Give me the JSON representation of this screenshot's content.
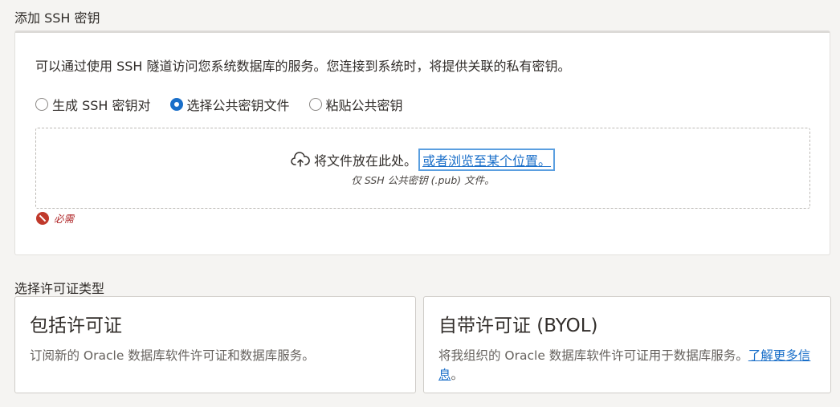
{
  "ssh_section": {
    "title": "添加 SSH 密钥",
    "description": "可以通过使用 SSH 隧道访问您系统数据库的服务。您连接到系统时，将提供关联的私有密钥。",
    "options": [
      {
        "label": "生成 SSH 密钥对",
        "selected": false
      },
      {
        "label": "选择公共密钥文件",
        "selected": true
      },
      {
        "label": "粘贴公共密钥",
        "selected": false
      }
    ],
    "dropzone": {
      "drop_text": "将文件放在此处。",
      "browse_link": "或者浏览至某个位置。",
      "hint": "仅 SSH 公共密钥 (.pub) 文件。",
      "icon": "cloud-upload-icon"
    },
    "validation": {
      "message": "必需",
      "icon": "error-icon",
      "color": "#c0392b"
    }
  },
  "license_section": {
    "title": "选择许可证类型",
    "cards": [
      {
        "title": "包括许可证",
        "description": "订阅新的 Oracle 数据库软件许可证和数据库服务。"
      },
      {
        "title": "自带许可证 (BYOL)",
        "description": "将我组织的 Oracle 数据库软件许可证用于数据库服务。",
        "link": "了解更多信息",
        "suffix": "。"
      }
    ]
  },
  "colors": {
    "accent": "#1a6fc9",
    "error": "#b0282a",
    "background": "#f5f4f2"
  }
}
